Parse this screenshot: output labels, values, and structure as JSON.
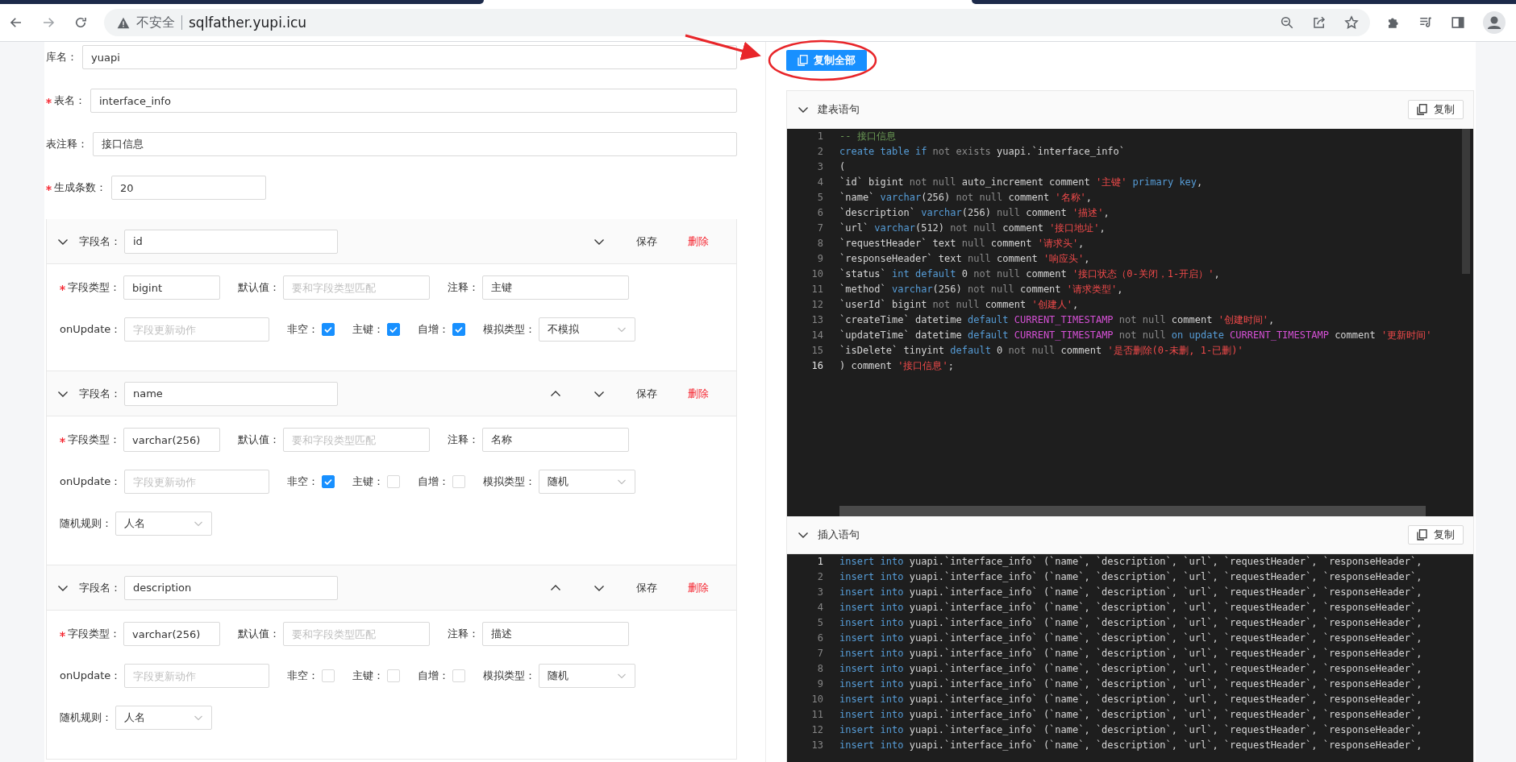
{
  "browser": {
    "security_label": "不安全",
    "url": "sqlfather.yupi.icu"
  },
  "table_form": {
    "fields": [
      {
        "kind": "text",
        "label": "库名：",
        "required": false,
        "value": "yuapi"
      },
      {
        "kind": "text",
        "label": "表名：",
        "required": true,
        "value": "interface_info"
      },
      {
        "kind": "text",
        "label": "表注释：",
        "required": false,
        "value": "接口信息"
      },
      {
        "kind": "number",
        "label": "生成条数：",
        "required": true,
        "value": "20"
      }
    ]
  },
  "columns": [
    {
      "expanded": true,
      "name_label": "字段名：",
      "name": "id",
      "move_up": false,
      "move_down": true,
      "save": "保存",
      "delete": "删除",
      "form_lines": [
        [
          {
            "kind": "input",
            "label": "字段类型：",
            "required": true,
            "value": "bigint"
          },
          {
            "kind": "input",
            "label": "默认值：",
            "required": false,
            "placeholder": "要和字段类型匹配"
          },
          {
            "kind": "input",
            "label": "注释：",
            "required": false,
            "value": "主键"
          }
        ],
        [
          {
            "kind": "input",
            "label": "onUpdate：",
            "required": false,
            "placeholder": "字段更新动作"
          },
          {
            "kind": "checkbox",
            "label": "非空：",
            "checked": true
          },
          {
            "kind": "checkbox",
            "label": "主键：",
            "checked": true
          },
          {
            "kind": "checkbox",
            "label": "自增：",
            "checked": true
          },
          {
            "kind": "select",
            "label": "模拟类型：",
            "value": "不模拟"
          }
        ]
      ]
    },
    {
      "expanded": true,
      "name_label": "字段名：",
      "name": "name",
      "move_up": true,
      "move_down": true,
      "save": "保存",
      "delete": "删除",
      "form_lines": [
        [
          {
            "kind": "input",
            "label": "字段类型：",
            "required": true,
            "value": "varchar(256)"
          },
          {
            "kind": "input",
            "label": "默认值：",
            "required": false,
            "placeholder": "要和字段类型匹配"
          },
          {
            "kind": "input",
            "label": "注释：",
            "required": false,
            "value": "名称"
          }
        ],
        [
          {
            "kind": "input",
            "label": "onUpdate：",
            "required": false,
            "placeholder": "字段更新动作"
          },
          {
            "kind": "checkbox",
            "label": "非空：",
            "checked": true
          },
          {
            "kind": "checkbox",
            "label": "主键：",
            "checked": false
          },
          {
            "kind": "checkbox",
            "label": "自增：",
            "checked": false
          },
          {
            "kind": "select",
            "label": "模拟类型：",
            "value": "随机"
          }
        ],
        [
          {
            "kind": "select",
            "label": "随机规则：",
            "value": "人名"
          }
        ]
      ]
    },
    {
      "expanded": true,
      "name_label": "字段名：",
      "name": "description",
      "move_up": true,
      "move_down": true,
      "save": "保存",
      "delete": "删除",
      "form_lines": [
        [
          {
            "kind": "input",
            "label": "字段类型：",
            "required": true,
            "value": "varchar(256)"
          },
          {
            "kind": "input",
            "label": "默认值：",
            "required": false,
            "placeholder": "要和字段类型匹配"
          },
          {
            "kind": "input",
            "label": "注释：",
            "required": false,
            "value": "描述"
          }
        ],
        [
          {
            "kind": "input",
            "label": "onUpdate：",
            "required": false,
            "placeholder": "字段更新动作"
          },
          {
            "kind": "checkbox",
            "label": "非空：",
            "checked": false
          },
          {
            "kind": "checkbox",
            "label": "主键：",
            "checked": false
          },
          {
            "kind": "checkbox",
            "label": "自增：",
            "checked": false
          },
          {
            "kind": "select",
            "label": "模拟类型：",
            "value": "随机"
          }
        ],
        [
          {
            "kind": "select",
            "label": "随机规则：",
            "value": "人名"
          }
        ]
      ]
    }
  ],
  "output": {
    "copy_all": "复制全部",
    "sections": [
      {
        "title": "建表语句",
        "expanded": true,
        "copy": "复制",
        "lines": [
          {
            "number": "1",
            "active": false,
            "tokens": [
              {
                "kind": "cmt",
                "text": "-- 接口信息"
              }
            ]
          },
          {
            "number": "2",
            "active": false,
            "tokens": [
              {
                "kind": "kw",
                "text": "create table if"
              },
              {
                "kind": "op",
                "text": " not exists"
              },
              {
                "kind": "txt",
                "text": " yuapi.`interface_info`"
              }
            ]
          },
          {
            "number": "3",
            "active": false,
            "tokens": [
              {
                "kind": "txt",
                "text": "("
              }
            ]
          },
          {
            "number": "4",
            "active": false,
            "tokens": [
              {
                "kind": "txt",
                "text": "`id` bigint"
              },
              {
                "kind": "op",
                "text": " not null"
              },
              {
                "kind": "txt",
                "text": " auto_increment comment "
              },
              {
                "kind": "str",
                "text": "'主键'"
              },
              {
                "kind": "kw",
                "text": " primary key"
              },
              {
                "kind": "txt",
                "text": ","
              }
            ]
          },
          {
            "number": "5",
            "active": false,
            "tokens": [
              {
                "kind": "txt",
                "text": "`name` "
              },
              {
                "kind": "kw",
                "text": "varchar"
              },
              {
                "kind": "txt",
                "text": "(256)"
              },
              {
                "kind": "op",
                "text": " not null"
              },
              {
                "kind": "txt",
                "text": " comment "
              },
              {
                "kind": "str",
                "text": "'名称'"
              },
              {
                "kind": "txt",
                "text": ","
              }
            ]
          },
          {
            "number": "6",
            "active": false,
            "tokens": [
              {
                "kind": "txt",
                "text": "`description` "
              },
              {
                "kind": "kw",
                "text": "varchar"
              },
              {
                "kind": "txt",
                "text": "(256)"
              },
              {
                "kind": "op",
                "text": " null"
              },
              {
                "kind": "txt",
                "text": " comment "
              },
              {
                "kind": "str",
                "text": "'描述'"
              },
              {
                "kind": "txt",
                "text": ","
              }
            ]
          },
          {
            "number": "7",
            "active": false,
            "tokens": [
              {
                "kind": "txt",
                "text": "`url` "
              },
              {
                "kind": "kw",
                "text": "varchar"
              },
              {
                "kind": "txt",
                "text": "(512)"
              },
              {
                "kind": "op",
                "text": " not null"
              },
              {
                "kind": "txt",
                "text": " comment "
              },
              {
                "kind": "str",
                "text": "'接口地址'"
              },
              {
                "kind": "txt",
                "text": ","
              }
            ]
          },
          {
            "number": "8",
            "active": false,
            "tokens": [
              {
                "kind": "txt",
                "text": "`requestHeader` text"
              },
              {
                "kind": "op",
                "text": " null"
              },
              {
                "kind": "txt",
                "text": " comment "
              },
              {
                "kind": "str",
                "text": "'请求头'"
              },
              {
                "kind": "txt",
                "text": ","
              }
            ]
          },
          {
            "number": "9",
            "active": false,
            "tokens": [
              {
                "kind": "txt",
                "text": "`responseHeader` text"
              },
              {
                "kind": "op",
                "text": " null"
              },
              {
                "kind": "txt",
                "text": " comment "
              },
              {
                "kind": "str",
                "text": "'响应头'"
              },
              {
                "kind": "txt",
                "text": ","
              }
            ]
          },
          {
            "number": "10",
            "active": false,
            "tokens": [
              {
                "kind": "txt",
                "text": "`status` "
              },
              {
                "kind": "kw",
                "text": "int default"
              },
              {
                "kind": "txt",
                "text": " 0"
              },
              {
                "kind": "op",
                "text": " not null"
              },
              {
                "kind": "txt",
                "text": " comment "
              },
              {
                "kind": "str",
                "text": "'接口状态（0-关闭，1-开启）'"
              },
              {
                "kind": "txt",
                "text": ","
              }
            ]
          },
          {
            "number": "11",
            "active": false,
            "tokens": [
              {
                "kind": "txt",
                "text": "`method` "
              },
              {
                "kind": "kw",
                "text": "varchar"
              },
              {
                "kind": "txt",
                "text": "(256)"
              },
              {
                "kind": "op",
                "text": " not null"
              },
              {
                "kind": "txt",
                "text": " comment "
              },
              {
                "kind": "str",
                "text": "'请求类型'"
              },
              {
                "kind": "txt",
                "text": ","
              }
            ]
          },
          {
            "number": "12",
            "active": false,
            "tokens": [
              {
                "kind": "txt",
                "text": "`userId` bigint"
              },
              {
                "kind": "op",
                "text": " not null"
              },
              {
                "kind": "txt",
                "text": " comment "
              },
              {
                "kind": "str",
                "text": "'创建人'"
              },
              {
                "kind": "txt",
                "text": ","
              }
            ]
          },
          {
            "number": "13",
            "active": false,
            "tokens": [
              {
                "kind": "txt",
                "text": "`createTime` datetime "
              },
              {
                "kind": "kw",
                "text": "default"
              },
              {
                "kind": "fn",
                "text": " CURRENT_TIMESTAMP"
              },
              {
                "kind": "op",
                "text": " not null"
              },
              {
                "kind": "txt",
                "text": " comment "
              },
              {
                "kind": "str",
                "text": "'创建时间'"
              },
              {
                "kind": "txt",
                "text": ","
              }
            ]
          },
          {
            "number": "14",
            "active": false,
            "tokens": [
              {
                "kind": "txt",
                "text": "`updateTime` datetime "
              },
              {
                "kind": "kw",
                "text": "default"
              },
              {
                "kind": "fn",
                "text": " CURRENT_TIMESTAMP"
              },
              {
                "kind": "op",
                "text": " not null"
              },
              {
                "kind": "kw",
                "text": " on update"
              },
              {
                "kind": "fn",
                "text": " CURRENT_TIMESTAMP"
              },
              {
                "kind": "txt",
                "text": " comment "
              },
              {
                "kind": "str",
                "text": "'更新时间'"
              }
            ]
          },
          {
            "number": "15",
            "active": false,
            "tokens": [
              {
                "kind": "txt",
                "text": "`isDelete` tinyint "
              },
              {
                "kind": "kw",
                "text": "default"
              },
              {
                "kind": "txt",
                "text": " 0"
              },
              {
                "kind": "op",
                "text": " not null"
              },
              {
                "kind": "txt",
                "text": " comment "
              },
              {
                "kind": "str",
                "text": "'是否删除(0-未删, 1-已删)'"
              }
            ]
          },
          {
            "number": "16",
            "active": true,
            "tokens": [
              {
                "kind": "txt",
                "text": ") comment "
              },
              {
                "kind": "str",
                "text": "'接口信息'"
              },
              {
                "kind": "txt",
                "text": ";"
              }
            ]
          }
        ]
      },
      {
        "title": "插入语句",
        "expanded": true,
        "copy": "复制",
        "lines": [
          {
            "number": "1",
            "active": true,
            "tokens": [
              {
                "kind": "kw",
                "text": "insert into"
              },
              {
                "kind": "txt",
                "text": " yuapi.`interface_info` (`name`, `description`, `url`, `requestHeader`, `responseHeader`,"
              }
            ]
          },
          {
            "number": "2",
            "active": false,
            "tokens": [
              {
                "kind": "kw",
                "text": "insert into"
              },
              {
                "kind": "txt",
                "text": " yuapi.`interface_info` (`name`, `description`, `url`, `requestHeader`, `responseHeader`,"
              }
            ]
          },
          {
            "number": "3",
            "active": false,
            "tokens": [
              {
                "kind": "kw",
                "text": "insert into"
              },
              {
                "kind": "txt",
                "text": " yuapi.`interface_info` (`name`, `description`, `url`, `requestHeader`, `responseHeader`,"
              }
            ]
          },
          {
            "number": "4",
            "active": false,
            "tokens": [
              {
                "kind": "kw",
                "text": "insert into"
              },
              {
                "kind": "txt",
                "text": " yuapi.`interface_info` (`name`, `description`, `url`, `requestHeader`, `responseHeader`,"
              }
            ]
          },
          {
            "number": "5",
            "active": false,
            "tokens": [
              {
                "kind": "kw",
                "text": "insert into"
              },
              {
                "kind": "txt",
                "text": " yuapi.`interface_info` (`name`, `description`, `url`, `requestHeader`, `responseHeader`,"
              }
            ]
          },
          {
            "number": "6",
            "active": false,
            "tokens": [
              {
                "kind": "kw",
                "text": "insert into"
              },
              {
                "kind": "txt",
                "text": " yuapi.`interface_info` (`name`, `description`, `url`, `requestHeader`, `responseHeader`,"
              }
            ]
          },
          {
            "number": "7",
            "active": false,
            "tokens": [
              {
                "kind": "kw",
                "text": "insert into"
              },
              {
                "kind": "txt",
                "text": " yuapi.`interface_info` (`name`, `description`, `url`, `requestHeader`, `responseHeader`,"
              }
            ]
          },
          {
            "number": "8",
            "active": false,
            "tokens": [
              {
                "kind": "kw",
                "text": "insert into"
              },
              {
                "kind": "txt",
                "text": " yuapi.`interface_info` (`name`, `description`, `url`, `requestHeader`, `responseHeader`,"
              }
            ]
          },
          {
            "number": "9",
            "active": false,
            "tokens": [
              {
                "kind": "kw",
                "text": "insert into"
              },
              {
                "kind": "txt",
                "text": " yuapi.`interface_info` (`name`, `description`, `url`, `requestHeader`, `responseHeader`,"
              }
            ]
          },
          {
            "number": "10",
            "active": false,
            "tokens": [
              {
                "kind": "kw",
                "text": "insert into"
              },
              {
                "kind": "txt",
                "text": " yuapi.`interface_info` (`name`, `description`, `url`, `requestHeader`, `responseHeader`,"
              }
            ]
          },
          {
            "number": "11",
            "active": false,
            "tokens": [
              {
                "kind": "kw",
                "text": "insert into"
              },
              {
                "kind": "txt",
                "text": " yuapi.`interface_info` (`name`, `description`, `url`, `requestHeader`, `responseHeader`,"
              }
            ]
          },
          {
            "number": "12",
            "active": false,
            "tokens": [
              {
                "kind": "kw",
                "text": "insert into"
              },
              {
                "kind": "txt",
                "text": " yuapi.`interface_info` (`name`, `description`, `url`, `requestHeader`, `responseHeader`,"
              }
            ]
          },
          {
            "number": "13",
            "active": false,
            "tokens": [
              {
                "kind": "kw",
                "text": "insert into"
              },
              {
                "kind": "txt",
                "text": " yuapi.`interface_info` (`name`, `description`, `url`, `requestHeader`, `responseHeader`,"
              }
            ]
          }
        ]
      }
    ]
  }
}
